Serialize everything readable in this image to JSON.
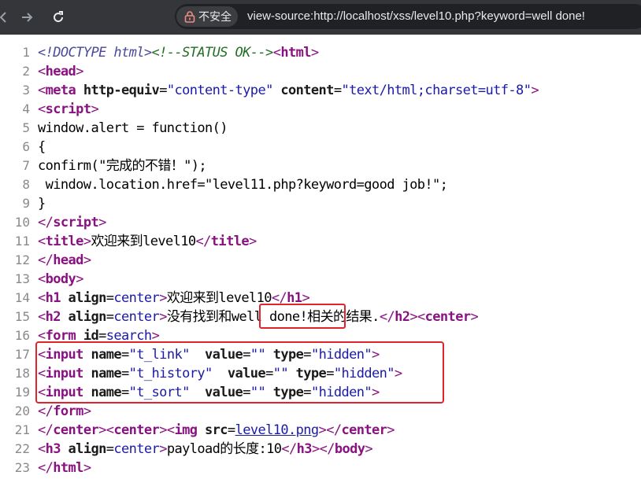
{
  "browser": {
    "security_label": "不安全",
    "url": "view-source:http://localhost/xss/level10.php?keyword=well done!"
  },
  "source_lines": [
    {
      "n": "1",
      "parts": [
        {
          "t": "<!DOCTYPE html>",
          "c": "dt"
        },
        {
          "t": "<!--STATUS OK-->",
          "c": "cmt"
        },
        {
          "t": "<",
          "c": "tag"
        },
        {
          "t": "html",
          "c": "tagname"
        },
        {
          "t": ">",
          "c": "tag"
        }
      ]
    },
    {
      "n": "2",
      "parts": [
        {
          "t": "<",
          "c": "tag"
        },
        {
          "t": "head",
          "c": "tagname"
        },
        {
          "t": ">",
          "c": "tag"
        }
      ]
    },
    {
      "n": "3",
      "parts": [
        {
          "t": "<",
          "c": "tag"
        },
        {
          "t": "meta ",
          "c": "tagname"
        },
        {
          "t": "http-equiv",
          "c": "attr"
        },
        {
          "t": "=",
          "c": ""
        },
        {
          "t": "\"content-type\"",
          "c": "val"
        },
        {
          "t": " content",
          "c": "attr"
        },
        {
          "t": "=",
          "c": ""
        },
        {
          "t": "\"text/html;charset=utf-8\"",
          "c": "val"
        },
        {
          "t": ">",
          "c": "tag"
        }
      ]
    },
    {
      "n": "4",
      "parts": [
        {
          "t": "<",
          "c": "tag"
        },
        {
          "t": "script",
          "c": "tagname"
        },
        {
          "t": ">",
          "c": "tag"
        }
      ]
    },
    {
      "n": "5",
      "parts": [
        {
          "t": "window.alert = function()",
          "c": ""
        }
      ]
    },
    {
      "n": "6",
      "parts": [
        {
          "t": "{",
          "c": ""
        }
      ]
    },
    {
      "n": "7",
      "parts": [
        {
          "t": "confirm(\"完成的不错！\");",
          "c": ""
        }
      ]
    },
    {
      "n": "8",
      "parts": [
        {
          "t": " window.location.href=\"level11.php?keyword=good job!\";",
          "c": ""
        }
      ]
    },
    {
      "n": "9",
      "parts": [
        {
          "t": "}",
          "c": ""
        }
      ]
    },
    {
      "n": "10",
      "parts": [
        {
          "t": "</",
          "c": "tag"
        },
        {
          "t": "script",
          "c": "tagname"
        },
        {
          "t": ">",
          "c": "tag"
        }
      ]
    },
    {
      "n": "11",
      "parts": [
        {
          "t": "<",
          "c": "tag"
        },
        {
          "t": "title",
          "c": "tagname"
        },
        {
          "t": ">",
          "c": "tag"
        },
        {
          "t": "欢迎来到level10",
          "c": ""
        },
        {
          "t": "</",
          "c": "tag"
        },
        {
          "t": "title",
          "c": "tagname"
        },
        {
          "t": ">",
          "c": "tag"
        }
      ]
    },
    {
      "n": "12",
      "parts": [
        {
          "t": "</",
          "c": "tag"
        },
        {
          "t": "head",
          "c": "tagname"
        },
        {
          "t": ">",
          "c": "tag"
        }
      ]
    },
    {
      "n": "13",
      "parts": [
        {
          "t": "<",
          "c": "tag"
        },
        {
          "t": "body",
          "c": "tagname"
        },
        {
          "t": ">",
          "c": "tag"
        }
      ]
    },
    {
      "n": "14",
      "parts": [
        {
          "t": "<",
          "c": "tag"
        },
        {
          "t": "h1 ",
          "c": "tagname"
        },
        {
          "t": "align",
          "c": "attr"
        },
        {
          "t": "=",
          "c": ""
        },
        {
          "t": "center",
          "c": "val"
        },
        {
          "t": ">",
          "c": "tag"
        },
        {
          "t": "欢迎来到level10",
          "c": ""
        },
        {
          "t": "</",
          "c": "tag"
        },
        {
          "t": "h1",
          "c": "tagname"
        },
        {
          "t": ">",
          "c": "tag"
        }
      ]
    },
    {
      "n": "15",
      "parts": [
        {
          "t": "<",
          "c": "tag"
        },
        {
          "t": "h2 ",
          "c": "tagname"
        },
        {
          "t": "align",
          "c": "attr"
        },
        {
          "t": "=",
          "c": ""
        },
        {
          "t": "center",
          "c": "val"
        },
        {
          "t": ">",
          "c": "tag"
        },
        {
          "t": "没有找到和well done!相关的结果.",
          "c": ""
        },
        {
          "t": "</",
          "c": "tag"
        },
        {
          "t": "h2",
          "c": "tagname"
        },
        {
          "t": ">",
          "c": "tag"
        },
        {
          "t": "<",
          "c": "tag"
        },
        {
          "t": "center",
          "c": "tagname"
        },
        {
          "t": ">",
          "c": "tag"
        }
      ]
    },
    {
      "n": "16",
      "parts": [
        {
          "t": "<",
          "c": "tag"
        },
        {
          "t": "form ",
          "c": "tagname"
        },
        {
          "t": "id",
          "c": "attr"
        },
        {
          "t": "=",
          "c": ""
        },
        {
          "t": "search",
          "c": "val"
        },
        {
          "t": ">",
          "c": "tag"
        }
      ]
    },
    {
      "n": "17",
      "parts": [
        {
          "t": "<",
          "c": "tag"
        },
        {
          "t": "input ",
          "c": "tagname"
        },
        {
          "t": "name",
          "c": "attr"
        },
        {
          "t": "=",
          "c": ""
        },
        {
          "t": "\"t_link\"",
          "c": "val"
        },
        {
          "t": "  value",
          "c": "attr"
        },
        {
          "t": "=",
          "c": ""
        },
        {
          "t": "\"\"",
          "c": "val"
        },
        {
          "t": " type",
          "c": "attr"
        },
        {
          "t": "=",
          "c": ""
        },
        {
          "t": "\"hidden\"",
          "c": "val"
        },
        {
          "t": ">",
          "c": "tag"
        }
      ]
    },
    {
      "n": "18",
      "parts": [
        {
          "t": "<",
          "c": "tag"
        },
        {
          "t": "input ",
          "c": "tagname"
        },
        {
          "t": "name",
          "c": "attr"
        },
        {
          "t": "=",
          "c": ""
        },
        {
          "t": "\"t_history\"",
          "c": "val"
        },
        {
          "t": "  value",
          "c": "attr"
        },
        {
          "t": "=",
          "c": ""
        },
        {
          "t": "\"\"",
          "c": "val"
        },
        {
          "t": " type",
          "c": "attr"
        },
        {
          "t": "=",
          "c": ""
        },
        {
          "t": "\"hidden\"",
          "c": "val"
        },
        {
          "t": ">",
          "c": "tag"
        }
      ]
    },
    {
      "n": "19",
      "parts": [
        {
          "t": "<",
          "c": "tag"
        },
        {
          "t": "input ",
          "c": "tagname"
        },
        {
          "t": "name",
          "c": "attr"
        },
        {
          "t": "=",
          "c": ""
        },
        {
          "t": "\"t_sort\"",
          "c": "val"
        },
        {
          "t": "  value",
          "c": "attr"
        },
        {
          "t": "=",
          "c": ""
        },
        {
          "t": "\"\"",
          "c": "val"
        },
        {
          "t": " type",
          "c": "attr"
        },
        {
          "t": "=",
          "c": ""
        },
        {
          "t": "\"hidden\"",
          "c": "val"
        },
        {
          "t": ">",
          "c": "tag"
        }
      ]
    },
    {
      "n": "20",
      "parts": [
        {
          "t": "</",
          "c": "tag"
        },
        {
          "t": "form",
          "c": "tagname"
        },
        {
          "t": ">",
          "c": "tag"
        }
      ]
    },
    {
      "n": "21",
      "parts": [
        {
          "t": "</",
          "c": "tag"
        },
        {
          "t": "center",
          "c": "tagname"
        },
        {
          "t": ">",
          "c": "tag"
        },
        {
          "t": "<",
          "c": "tag"
        },
        {
          "t": "center",
          "c": "tagname"
        },
        {
          "t": ">",
          "c": "tag"
        },
        {
          "t": "<",
          "c": "tag"
        },
        {
          "t": "img ",
          "c": "tagname"
        },
        {
          "t": "src",
          "c": "attr"
        },
        {
          "t": "=",
          "c": ""
        },
        {
          "t": "level10.png",
          "c": "link"
        },
        {
          "t": ">",
          "c": "tag"
        },
        {
          "t": "</",
          "c": "tag"
        },
        {
          "t": "center",
          "c": "tagname"
        },
        {
          "t": ">",
          "c": "tag"
        }
      ]
    },
    {
      "n": "22",
      "parts": [
        {
          "t": "<",
          "c": "tag"
        },
        {
          "t": "h3 ",
          "c": "tagname"
        },
        {
          "t": "align",
          "c": "attr"
        },
        {
          "t": "=",
          "c": ""
        },
        {
          "t": "center",
          "c": "val"
        },
        {
          "t": ">",
          "c": "tag"
        },
        {
          "t": "payload的长度:10",
          "c": ""
        },
        {
          "t": "</",
          "c": "tag"
        },
        {
          "t": "h3",
          "c": "tagname"
        },
        {
          "t": ">",
          "c": "tag"
        },
        {
          "t": "</",
          "c": "tag"
        },
        {
          "t": "body",
          "c": "tagname"
        },
        {
          "t": ">",
          "c": "tag"
        }
      ]
    },
    {
      "n": "23",
      "parts": [
        {
          "t": "</",
          "c": "tag"
        },
        {
          "t": "html",
          "c": "tagname"
        },
        {
          "t": ">",
          "c": "tag"
        }
      ]
    }
  ],
  "colors": {
    "highlight": "#e0242b",
    "toolbar": "#35363a"
  }
}
